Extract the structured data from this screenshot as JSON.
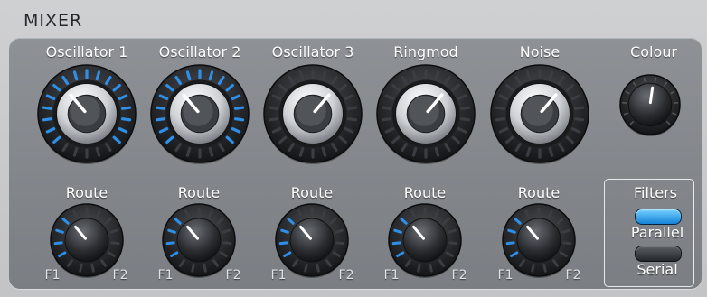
{
  "title": "MIXER",
  "sources": [
    {
      "label": "Oscillator 1",
      "level": 0.35,
      "active": true
    },
    {
      "label": "Oscillator 2",
      "level": 0.35,
      "active": true
    },
    {
      "label": "Oscillator 3",
      "level": 0.65,
      "active": false
    },
    {
      "label": "Ringmod",
      "level": 0.65,
      "active": false
    },
    {
      "label": "Noise",
      "level": 0.65,
      "active": false
    }
  ],
  "colour": {
    "label": "Colour",
    "level": 0.53
  },
  "routes": [
    {
      "label": "Route",
      "left": "F1",
      "right": "F2",
      "value": 0.35
    },
    {
      "label": "Route",
      "left": "F1",
      "right": "F2",
      "value": 0.35
    },
    {
      "label": "Route",
      "left": "F1",
      "right": "F2",
      "value": 0.35
    },
    {
      "label": "Route",
      "left": "F1",
      "right": "F2",
      "value": 0.35
    },
    {
      "label": "Route",
      "left": "F1",
      "right": "F2",
      "value": 0.35
    }
  ],
  "filters": {
    "title": "Filters",
    "parallel": {
      "label": "Parallel",
      "active": true
    },
    "serial": {
      "label": "Serial",
      "active": false
    }
  },
  "colors": {
    "accent": "#2f8fe8",
    "panel": "#878b90",
    "label": "#ffffff"
  }
}
